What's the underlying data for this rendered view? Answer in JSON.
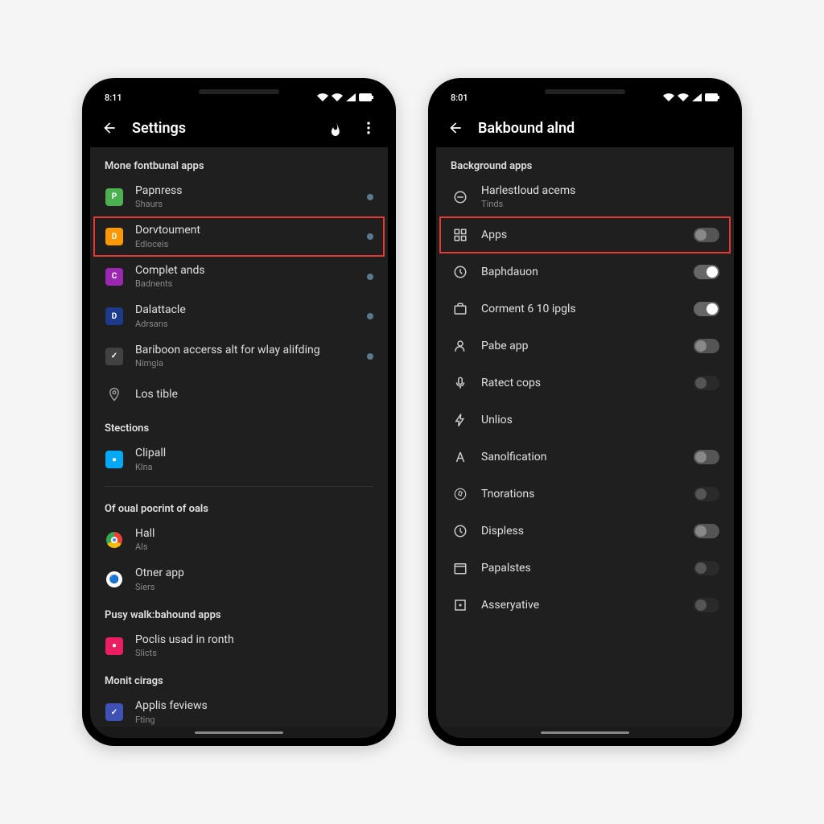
{
  "phones": [
    {
      "status_time": "8:11",
      "title": "Settings",
      "show_flame": true,
      "show_more": true,
      "sections": [
        {
          "header": "Mone fontbunal apps",
          "items": [
            {
              "icon_bg": "#4caf50",
              "icon_glyph": "P",
              "label": "Papnress",
              "sublabel": "Shaurs",
              "trail": "dot"
            },
            {
              "icon_bg": "#ff9800",
              "icon_glyph": "D",
              "label": "Dorvtoument",
              "sublabel": "Edloceis",
              "trail": "dot",
              "highlighted": true
            },
            {
              "icon_bg": "#9c27b0",
              "icon_glyph": "C",
              "label": "Complet ands",
              "sublabel": "Badnents",
              "trail": "dot"
            },
            {
              "icon_bg": "#1e3a8a",
              "icon_glyph": "D",
              "label": "Dalattacle",
              "sublabel": "Adrsans",
              "trail": "dot"
            },
            {
              "icon_bg": "#424242",
              "icon_glyph": "✓",
              "label": "Bariboon accerss alt for wlay alifding",
              "sublabel": "Nimgla",
              "trail": "dot"
            },
            {
              "icon_svg": "pin",
              "label": "Los tible",
              "sublabel": "",
              "trail": ""
            }
          ]
        },
        {
          "header": "Stections",
          "items": [
            {
              "icon_bg": "#03a9f4",
              "icon_glyph": "●",
              "label": "Clipall",
              "sublabel": "Klna",
              "trail": ""
            }
          ],
          "divider_after": true
        },
        {
          "header": "Of oual pocrint of oals",
          "items": [
            {
              "icon_bg": "",
              "icon_glyph": "chrome",
              "label": "Hall",
              "sublabel": "Als",
              "trail": ""
            },
            {
              "icon_bg": "",
              "icon_glyph": "multi",
              "label": "Otner app",
              "sublabel": "Siers",
              "trail": ""
            }
          ]
        },
        {
          "header": "Pusy walk:bahound apps",
          "items": [
            {
              "icon_bg": "#e91e63",
              "icon_glyph": "●",
              "label": "Poclis usad in ronth",
              "sublabel": "Slicts",
              "trail": ""
            }
          ]
        },
        {
          "header": "Monit cirags",
          "items": [
            {
              "icon_bg": "#3f51b5",
              "icon_glyph": "✓",
              "label": "Applis feviews",
              "sublabel": "Fting",
              "trail": ""
            }
          ]
        }
      ]
    },
    {
      "status_time": "8:01",
      "title": "Bakbound alnd",
      "show_flame": false,
      "show_more": false,
      "sections": [
        {
          "header": "Background apps",
          "items": [
            {
              "icon_svg": "circle-minus",
              "label": "Harlestloud acems",
              "sublabel": "Tinds",
              "trail": ""
            },
            {
              "icon_svg": "grid",
              "label": "Apps",
              "sublabel": "",
              "trail": "toggle-off",
              "highlighted": true
            },
            {
              "icon_svg": "clock",
              "label": "Baphdauon",
              "sublabel": "",
              "trail": "toggle-on"
            },
            {
              "icon_svg": "briefcase",
              "label": "Corment 6 10 ipgls",
              "sublabel": "",
              "trail": "toggle-on"
            },
            {
              "icon_svg": "person",
              "label": "Pabe app",
              "sublabel": "",
              "trail": "toggle-off"
            },
            {
              "icon_svg": "mic",
              "label": "Ratect cops",
              "sublabel": "",
              "trail": "toggle-off-dark"
            },
            {
              "icon_svg": "bolt",
              "label": "Unlios",
              "sublabel": "",
              "trail": ""
            },
            {
              "icon_svg": "font",
              "label": "Sanolfication",
              "sublabel": "",
              "trail": "toggle-off"
            },
            {
              "icon_svg": "compass",
              "label": "Tnorations",
              "sublabel": "",
              "trail": "toggle-off-dark"
            },
            {
              "icon_svg": "clock",
              "label": "Displess",
              "sublabel": "",
              "trail": "toggle-off"
            },
            {
              "icon_svg": "calendar",
              "label": "Papalstes",
              "sublabel": "",
              "trail": "toggle-off-dark"
            },
            {
              "icon_svg": "square",
              "label": "Asseryative",
              "sublabel": "",
              "trail": "toggle-off-dark"
            }
          ]
        }
      ]
    }
  ]
}
